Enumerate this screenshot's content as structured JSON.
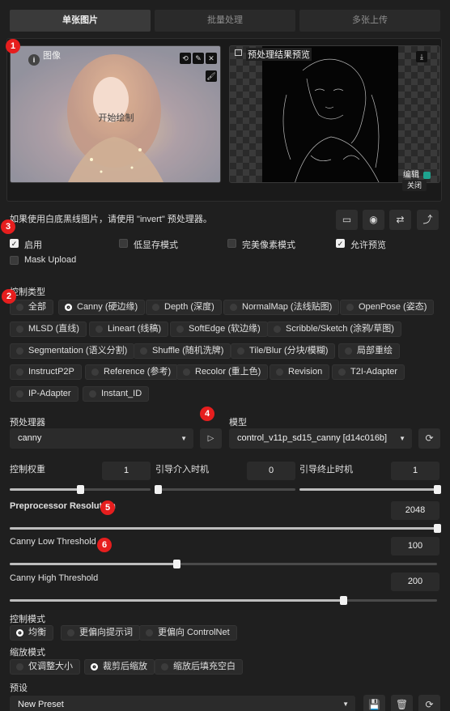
{
  "tabs": [
    "单张图片",
    "批量处理",
    "多张上传"
  ],
  "image_panel": {
    "input_label": "图像",
    "draw_text": "开始绘制",
    "preview_label": "预处理结果预览",
    "edit_label": "编辑",
    "close_label": "关闭"
  },
  "hint_text": "如果使用白底黑线图片，请使用 \"invert\" 预处理器。",
  "checkboxes": {
    "enable": "启用",
    "low_vram": "低显存模式",
    "pixel_perfect": "完美像素模式",
    "allow_preview": "允许预览",
    "mask_upload": "Mask Upload"
  },
  "control_type": {
    "label": "控制类型",
    "options": [
      "全部",
      "Canny (硬边缘)",
      "Depth (深度)",
      "NormalMap (法线贴图)",
      "OpenPose (姿态)",
      "MLSD (直线)",
      "Lineart (线稿)",
      "SoftEdge (软边缘)",
      "Scribble/Sketch (涂鸦/草图)",
      "Segmentation (语义分割)",
      "Shuffle (随机洗牌)",
      "Tile/Blur (分块/模糊)",
      "局部重绘",
      "InstructP2P",
      "Reference (参考)",
      "Recolor (重上色)",
      "Revision",
      "T2I-Adapter",
      "IP-Adapter",
      "Instant_ID"
    ],
    "selected": "Canny (硬边缘)"
  },
  "preprocessor": {
    "label": "预处理器",
    "value": "canny"
  },
  "model": {
    "label": "模型",
    "value": "control_v11p_sd15_canny [d14c016b]"
  },
  "control_weight": {
    "label": "控制权重",
    "value": "1",
    "fraction": 0.5
  },
  "guidance_start": {
    "label": "引导介入时机",
    "value": "0",
    "fraction": 0.0
  },
  "guidance_end": {
    "label": "引导终止时机",
    "value": "1",
    "fraction": 1.0
  },
  "pre_res": {
    "label": "Preprocessor Resolution",
    "value": "2048",
    "fraction": 1.0
  },
  "low_th": {
    "label": "Canny Low Threshold",
    "value": "100",
    "fraction": 0.39
  },
  "high_th": {
    "label": "Canny High Threshold",
    "value": "200",
    "fraction": 0.78
  },
  "control_mode": {
    "label": "控制模式",
    "options": [
      "均衡",
      "更偏向提示词",
      "更偏向 ControlNet"
    ],
    "selected": "均衡"
  },
  "resize_mode": {
    "label": "缩放模式",
    "options": [
      "仅调整大小",
      "裁剪后缩放",
      "缩放后填充空白"
    ],
    "selected": "裁剪后缩放"
  },
  "preset": {
    "label": "预设",
    "value": "New Preset"
  },
  "annotations": [
    "1",
    "2",
    "3",
    "4",
    "5",
    "6"
  ],
  "colors": {
    "badge": "#e61e1e",
    "background": "#1f1f1f"
  }
}
